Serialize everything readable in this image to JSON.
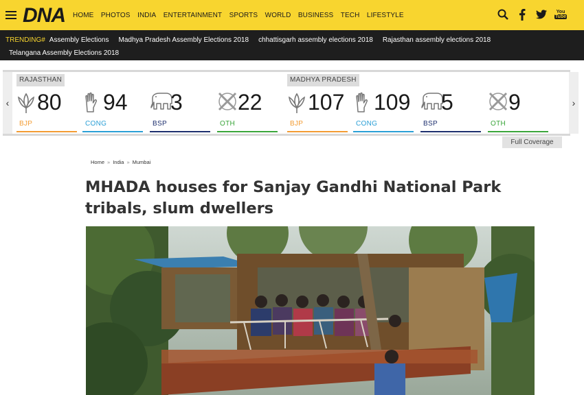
{
  "header": {
    "logo": "DNA",
    "nav": [
      "HOME",
      "PHOTOS",
      "INDIA",
      "ENTERTAINMENT",
      "SPORTS",
      "WORLD",
      "BUSINESS",
      "TECH",
      "LIFESTYLE"
    ],
    "icons": [
      "search-icon",
      "facebook-icon",
      "twitter-icon",
      "youtube-icon"
    ],
    "youtube_text_top": "You",
    "youtube_text_bottom": "Tube"
  },
  "trending": {
    "label": "TRENDING#",
    "links": [
      "Assembly Elections",
      "Madhya Pradesh Assembly Elections 2018",
      "chhattisgarh assembly elections 2018",
      "Rajasthan assembly elections 2018",
      "Telangana Assembly Elections 2018"
    ]
  },
  "elections": {
    "states": [
      {
        "name": "RAJASTHAN",
        "parties": [
          {
            "party": "BJP",
            "seats": "80",
            "color": "#f39c33",
            "symbol": "lotus-icon"
          },
          {
            "party": "CONG",
            "seats": "94",
            "color": "#2a9fd6",
            "symbol": "hand-icon"
          },
          {
            "party": "BSP",
            "seats": "3",
            "color": "#1d2f6e",
            "symbol": "elephant-icon"
          },
          {
            "party": "OTH",
            "seats": "22",
            "color": "#3aa53a",
            "symbol": "others-icon"
          }
        ]
      },
      {
        "name": "MADHYA PRADESH",
        "parties": [
          {
            "party": "BJP",
            "seats": "107",
            "color": "#f39c33",
            "symbol": "lotus-icon"
          },
          {
            "party": "CONG",
            "seats": "109",
            "color": "#2a9fd6",
            "symbol": "hand-icon"
          },
          {
            "party": "BSP",
            "seats": "5",
            "color": "#1d2f6e",
            "symbol": "elephant-icon"
          },
          {
            "party": "OTH",
            "seats": "9",
            "color": "#3aa53a",
            "symbol": "others-icon"
          }
        ]
      }
    ],
    "full_coverage": "Full Coverage"
  },
  "breadcrumb": [
    "Home",
    "India",
    "Mumbai"
  ],
  "breadcrumb_sep": "»",
  "article": {
    "title": "MHADA houses for Sanjay Gandhi National Park tribals, slum dwellers"
  },
  "colors": {
    "header_bg": "#f8d52f",
    "trending_bg": "#1e1e1e",
    "trending_label": "#f8d52f"
  }
}
